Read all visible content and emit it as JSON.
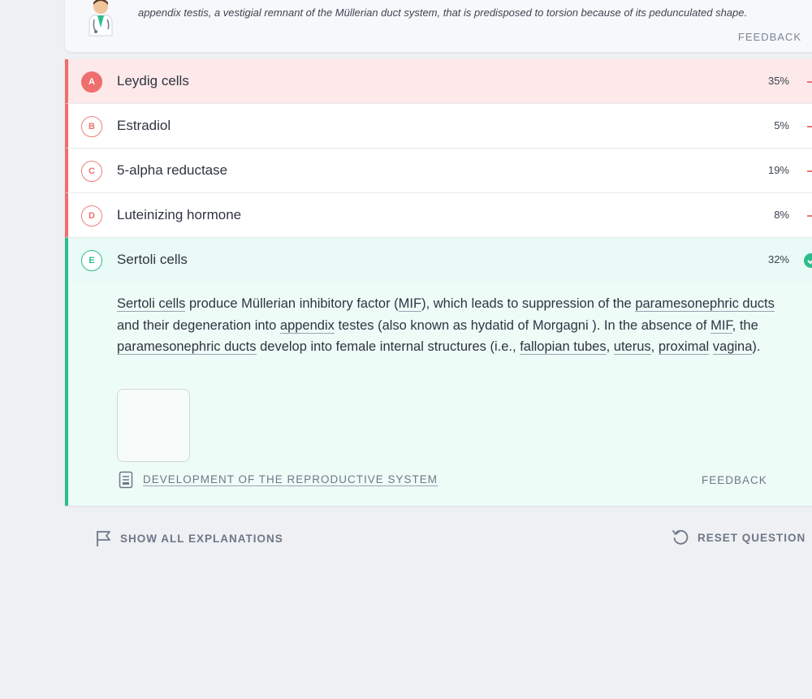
{
  "top_card": {
    "text": "appendix testis, a vestigial remnant of the Müllerian duct system, that is predisposed to torsion because of its pedunculated shape.",
    "feedback_label": "FEEDBACK"
  },
  "answers": [
    {
      "letter": "A",
      "text": "Leydig cells",
      "percent": "35%",
      "state": "selected-incorrect"
    },
    {
      "letter": "B",
      "text": "Estradiol",
      "percent": "5%",
      "state": "incorrect"
    },
    {
      "letter": "C",
      "text": "5-alpha reductase",
      "percent": "19%",
      "state": "incorrect"
    },
    {
      "letter": "D",
      "text": "Luteinizing hormone",
      "percent": "8%",
      "state": "incorrect"
    },
    {
      "letter": "E",
      "text": "Sertoli cells",
      "percent": "32%",
      "state": "correct"
    }
  ],
  "explanation": {
    "seg": [
      "Sertoli cells",
      " produce Müllerian inhibitory factor (",
      "MIF",
      "), which leads to suppression of the ",
      "paramesonephric ducts",
      " and their degeneration into ",
      "appendix",
      " testes (also known as hydatid of Morgagni ). In the absence of ",
      "MIF",
      ", the ",
      "paramesonephric ducts",
      " develop into female internal structures (i.e., ",
      "fallopian tubes",
      ", ",
      "uterus",
      ", ",
      "proximal",
      " ",
      "vagina",
      ")."
    ],
    "article_link": "DEVELOPMENT OF THE REPRODUCTIVE SYSTEM",
    "feedback_label": "FEEDBACK"
  },
  "bottom": {
    "show_all": "SHOW ALL EXPLANATIONS",
    "reset": "RESET QUESTION"
  },
  "colors": {
    "incorrect": "#ef6f6f",
    "correct": "#2dbd8c",
    "background": "#eef0f3"
  },
  "icons": [
    "doctor-avatar-icon",
    "check-circle-icon",
    "document-icon",
    "flag-icon",
    "reset-icon"
  ]
}
